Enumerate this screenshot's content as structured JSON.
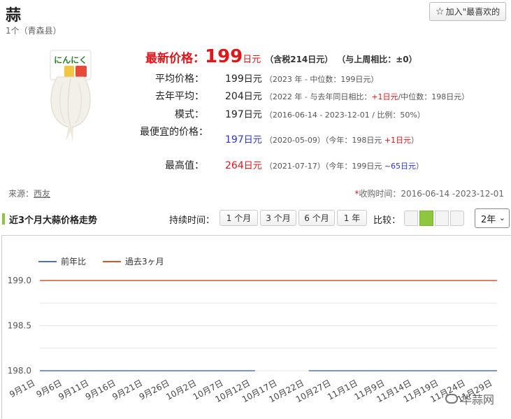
{
  "product": {
    "name": "蒜",
    "subtitle": "1个（青森县）",
    "package_text": "にんにく"
  },
  "favorite_button": "加入\"最喜欢的",
  "latest": {
    "label": "最新价格：",
    "price": "199",
    "unit": "日元",
    "tax": "（含税214日元）",
    "week": "（与上周相比：±0）"
  },
  "stats": [
    {
      "label": "平均价格：",
      "value": "199",
      "unit": "日元",
      "note_parts": [
        {
          "t": "（2023 年 - 中位数：199日元）",
          "c": ""
        }
      ]
    },
    {
      "label": "去年平均：",
      "value": "204",
      "unit": "日元",
      "note_parts": [
        {
          "t": "（2022 年 - 与去年同日相比：",
          "c": ""
        },
        {
          "t": "+1日元",
          "c": "red"
        },
        {
          "t": "/中位数：198日元）",
          "c": ""
        }
      ]
    },
    {
      "label": "模式：",
      "value": "197",
      "unit": "日元",
      "note_parts": [
        {
          "t": "（2016-06-14 - 2023-12-01 / 比例：50%）",
          "c": ""
        }
      ]
    },
    {
      "label": "最便宜的价格：",
      "value": "197",
      "unit": "日元",
      "color": "blue",
      "note_parts": [
        {
          "t": "（2020-05-09）（今年：198日元 ",
          "c": ""
        },
        {
          "t": "+1日元",
          "c": "red"
        },
        {
          "t": "）",
          "c": ""
        }
      ]
    },
    {
      "label": "最高值：",
      "value": "264",
      "unit": "日元",
      "color": "red",
      "note_parts": [
        {
          "t": "（2021-07-17）（今年：199日元 ",
          "c": ""
        },
        {
          "t": "~65日元",
          "c": "blue"
        },
        {
          "t": "）",
          "c": ""
        }
      ]
    }
  ],
  "source": {
    "label": "来源：",
    "link": "西友"
  },
  "collection": {
    "asterisk": "*",
    "text": "收购时间：2016-06-14 -2023-12-01"
  },
  "section_title": "近3个月大蒜价格走势",
  "duration": {
    "label": "持续时间：",
    "tabs": [
      "1 个月",
      "3 个月",
      "6 个月",
      "1 年"
    ]
  },
  "compare": {
    "label": "比较：",
    "selected_index": 1,
    "count": 4
  },
  "select": {
    "value": "2年"
  },
  "watermark": "华蒜网",
  "colors": {
    "accent_green": "#8dc63f",
    "price_red": "#e0161b",
    "series_blue": "#4c6fd3",
    "series_orange": "#d2552e"
  },
  "chart_data": {
    "type": "line",
    "categories": [
      "9月1日",
      "9月6日",
      "9月11日",
      "9月16日",
      "9月21日",
      "9月26日",
      "10月2日",
      "10月7日",
      "10月12日",
      "10月17日",
      "10月22日",
      "10月27日",
      "11月1日",
      "11月9日",
      "11月14日",
      "11月19日",
      "11月24日",
      "11月29日"
    ],
    "ylim": [
      198.0,
      199.0
    ],
    "yticks": [
      "199.0",
      "198.5",
      "198.0"
    ],
    "series": [
      {
        "name": "前年比",
        "color": "#4c6fd3",
        "values": [
          198,
          198,
          198,
          198,
          198,
          198,
          198,
          198,
          198,
          null,
          198,
          198,
          198,
          198,
          198,
          198,
          198,
          198
        ]
      },
      {
        "name": "過去3ヶ月",
        "color": "#d2552e",
        "values": [
          199,
          199,
          199,
          199,
          199,
          199,
          199,
          199,
          199,
          199,
          199,
          199,
          199,
          199,
          199,
          199,
          199,
          199
        ]
      }
    ],
    "legend": "top-left",
    "grid": true
  }
}
